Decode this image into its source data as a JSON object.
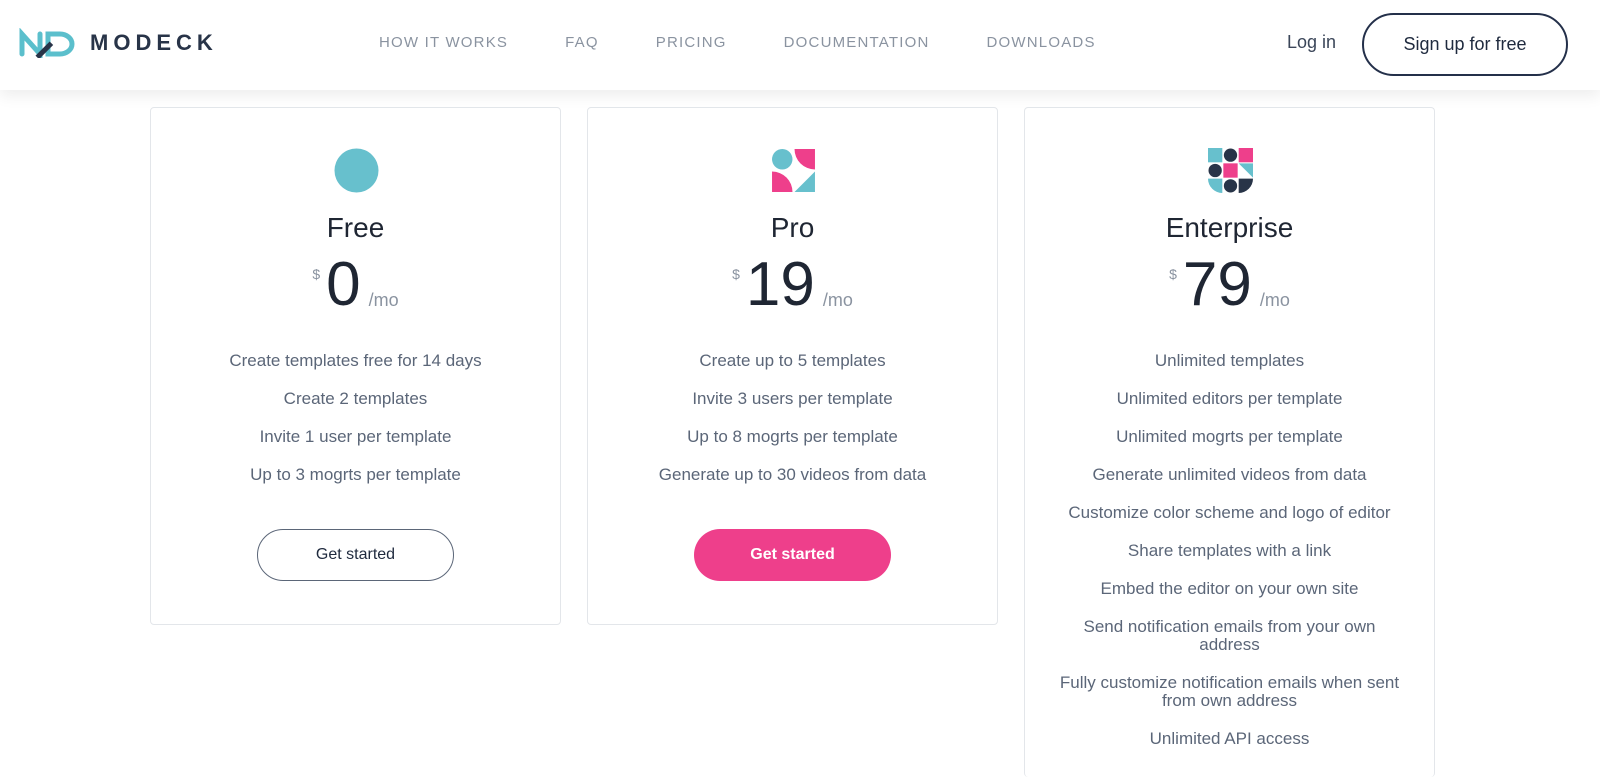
{
  "brand": {
    "name": "MODECK",
    "accent": "#5bbfcc",
    "pink": "#ee3f8b",
    "navy": "#283448"
  },
  "nav": [
    "HOW IT WORKS",
    "FAQ",
    "PRICING",
    "DOCUMENTATION",
    "DOWNLOADS"
  ],
  "header": {
    "login": "Log in",
    "signup": "Sign up for free"
  },
  "plans": [
    {
      "name": "Free",
      "currency": "$",
      "price": "0",
      "period": "/mo",
      "icon": "circle-plan-icon",
      "features": [
        "Create templates free for 14 days",
        "Create 2 templates",
        "Invite 1 user per template",
        "Up to 3 mogrts per template"
      ],
      "cta": "Get started"
    },
    {
      "name": "Pro",
      "currency": "$",
      "price": "19",
      "period": "/mo",
      "icon": "shapes-plan-icon",
      "features": [
        "Create up to 5 templates",
        "Invite 3 users per template",
        "Up to 8 mogrts per template",
        "Generate up to 30 videos from data"
      ],
      "cta": "Get started"
    },
    {
      "name": "Enterprise",
      "currency": "$",
      "price": "79",
      "period": "/mo",
      "icon": "mosaic-plan-icon",
      "features": [
        "Unlimited templates",
        "Unlimited editors per template",
        "Unlimited mogrts per template",
        "Generate unlimited videos from data",
        "Customize color scheme and logo of editor",
        "Share templates with a link",
        "Embed the editor on your own site",
        "Send notification emails from your own address",
        "Fully customize notification emails when sent from own address",
        "Unlimited API access"
      ]
    }
  ]
}
